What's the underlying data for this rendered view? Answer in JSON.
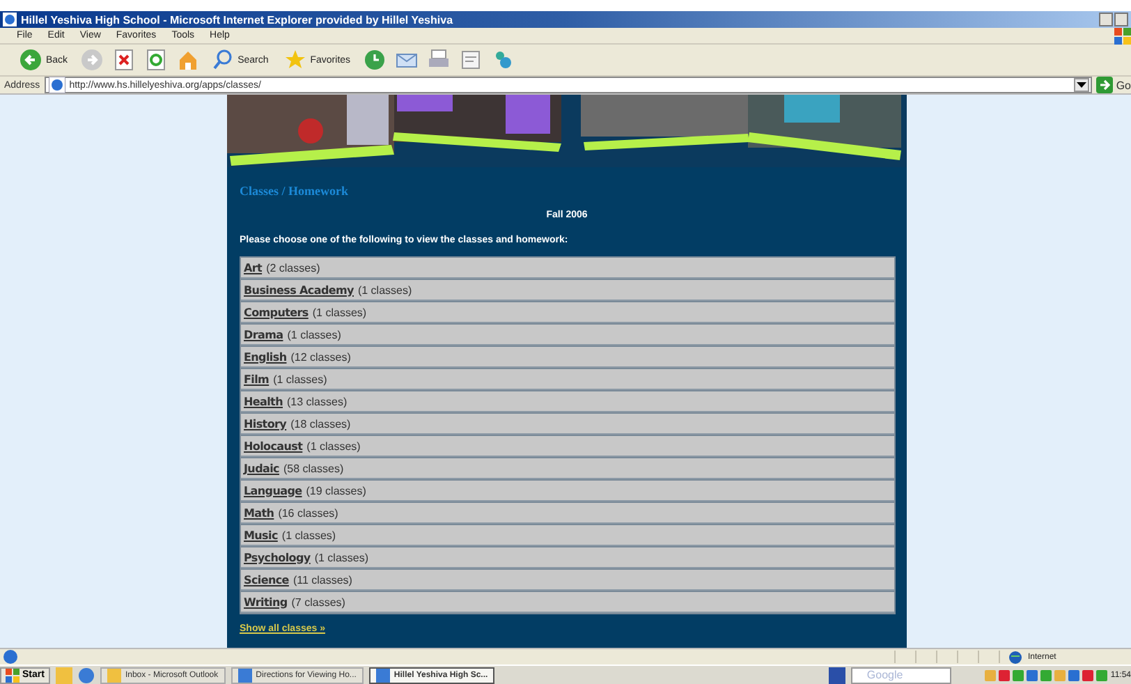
{
  "window": {
    "title": "Hillel Yeshiva High School - Microsoft Internet Explorer provided by Hillel Yeshiva"
  },
  "menu": [
    "File",
    "Edit",
    "View",
    "Favorites",
    "Tools",
    "Help"
  ],
  "toolbar": [
    {
      "kind": "back",
      "label": "Back"
    },
    {
      "kind": "search",
      "label": "Search"
    },
    {
      "kind": "favorites",
      "label": "Favorites"
    }
  ],
  "address_bar": {
    "label": "Address",
    "value": "http://www.hs.hillelyeshiva.org/apps/classes/",
    "go": "Go"
  },
  "page": {
    "heading": "Classes / Homework",
    "term": "Fall 2006",
    "prompt": "Please choose one of the following to view the classes and homework:",
    "subjects": [
      {
        "name": "Art",
        "count": "(2 classes)"
      },
      {
        "name": "Business Academy",
        "count": "(1 classes)"
      },
      {
        "name": "Computers",
        "count": "(1 classes)"
      },
      {
        "name": "Drama",
        "count": "(1 classes)"
      },
      {
        "name": "English",
        "count": "(12 classes)"
      },
      {
        "name": "Film",
        "count": "(1 classes)"
      },
      {
        "name": "Health",
        "count": "(13 classes)"
      },
      {
        "name": "History",
        "count": "(18 classes)"
      },
      {
        "name": "Holocaust",
        "count": "(1 classes)"
      },
      {
        "name": "Judaic",
        "count": "(58 classes)"
      },
      {
        "name": "Language",
        "count": "(19 classes)"
      },
      {
        "name": "Math",
        "count": "(16 classes)"
      },
      {
        "name": "Music",
        "count": "(1 classes)"
      },
      {
        "name": "Psychology",
        "count": "(1 classes)"
      },
      {
        "name": "Science",
        "count": "(11 classes)"
      },
      {
        "name": "Writing",
        "count": "(7 classes)"
      }
    ],
    "show_all": "Show all classes »"
  },
  "status_bar": {
    "zone": "Internet"
  },
  "taskbar": {
    "start": "Start",
    "tasks": [
      {
        "label": "Inbox - Microsoft Outlook",
        "selected": false
      },
      {
        "label": "Directions for Viewing Ho...",
        "selected": false
      },
      {
        "label": "Hillel Yeshiva High Sc...",
        "selected": true
      }
    ],
    "search": "Google",
    "clock": "11:54"
  }
}
